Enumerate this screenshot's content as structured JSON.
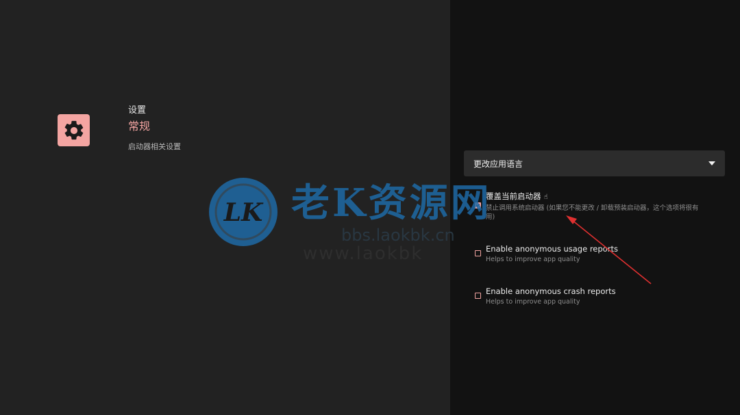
{
  "header": {
    "breadcrumb": "设置",
    "title": "常规",
    "subtitle": "启动器相关设置"
  },
  "icon": {
    "name": "gear-icon",
    "tile_color": "#f4a5a2"
  },
  "language_select": {
    "label": "更改应用语言"
  },
  "options": [
    {
      "title": "覆盖当前启动器",
      "desc_line1": "禁止调用系统启动器 (如果您不能更改 / 卸载预装启动器，这个选项将很有",
      "desc_line2": "用)",
      "checked": true
    },
    {
      "title": "Enable anonymous usage reports",
      "desc_line1": "Helps to improve app quality",
      "checked": false
    },
    {
      "title": "Enable anonymous crash reports",
      "desc_line1": "Helps to improve app quality",
      "checked": false
    }
  ],
  "watermark": {
    "logo": "LK",
    "main": "老K资源网",
    "url": "bbs.laokbk.cn",
    "www": "www.laokbk"
  },
  "colors": {
    "accent": "#f4a5a2",
    "left_bg": "#222222",
    "right_bg": "#121212",
    "annotation_arrow": "#e03030"
  }
}
